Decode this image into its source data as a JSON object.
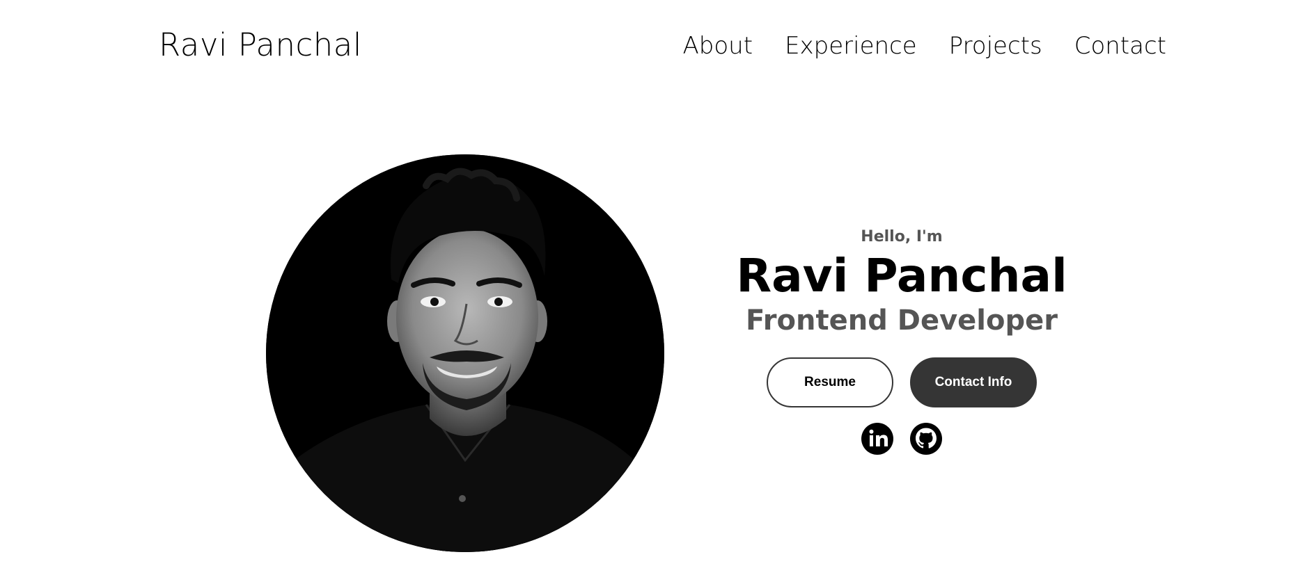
{
  "nav": {
    "logo": "Ravi Panchal",
    "links": [
      {
        "label": "About"
      },
      {
        "label": "Experience"
      },
      {
        "label": "Projects"
      },
      {
        "label": "Contact"
      }
    ]
  },
  "hero": {
    "greeting": "Hello, I'm",
    "name": "Ravi Panchal",
    "title": "Frontend Developer",
    "buttons": {
      "resume": "Resume",
      "contact": "Contact Info"
    },
    "socials": [
      {
        "icon": "linkedin-icon"
      },
      {
        "icon": "github-icon"
      }
    ],
    "profile_photo": {
      "icon": "profile-photo"
    }
  },
  "colors": {
    "text": "#000000",
    "muted": "#555555",
    "button_dark": "#353535",
    "background": "#ffffff"
  }
}
